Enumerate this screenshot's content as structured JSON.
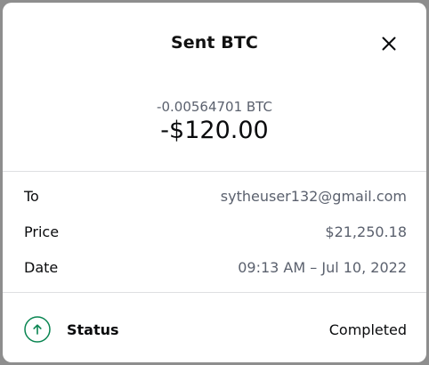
{
  "modal": {
    "title": "Sent BTC",
    "close_icon": "close-icon"
  },
  "amounts": {
    "crypto": "-0.00564701 BTC",
    "fiat": "-$120.00"
  },
  "details": {
    "to": {
      "label": "To",
      "value": "sytheuser132@gmail.com"
    },
    "price": {
      "label": "Price",
      "value": "$21,250.18"
    },
    "date": {
      "label": "Date",
      "value": "09:13 AM – Jul 10, 2022"
    }
  },
  "status": {
    "icon": "arrow-up-icon",
    "label": "Status",
    "value": "Completed",
    "color": "#098551"
  }
}
